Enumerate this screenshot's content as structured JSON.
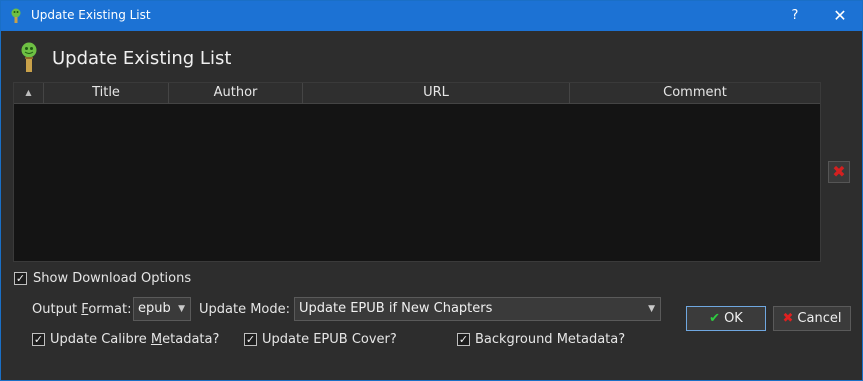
{
  "window": {
    "title": "Update Existing List",
    "help_label": "?",
    "close_label": "✕"
  },
  "header": {
    "title": "Update Existing List"
  },
  "table": {
    "sort_indicator": "▲",
    "columns": [
      "Title",
      "Author",
      "URL",
      "Comment"
    ],
    "rows": []
  },
  "remove_button": {
    "label": "✖"
  },
  "show_download_options": {
    "label": "Show Download Options",
    "checked": true
  },
  "output_format": {
    "label_pre": "Output ",
    "label_u": "F",
    "label_post": "ormat:",
    "value": "epub"
  },
  "update_mode": {
    "label": "Update Mode:",
    "value": "Update EPUB if New Chapters"
  },
  "options": {
    "update_calibre_pre": "Update Calibre ",
    "update_calibre_u": "M",
    "update_calibre_post": "etadata?",
    "update_epub_cover": "Update EPUB Cover?",
    "background_metadata": "Background Metadata?"
  },
  "buttons": {
    "ok": "OK",
    "cancel": "Cancel"
  },
  "colors": {
    "titlebar": "#1c72d4",
    "background": "#2d2d2d",
    "ok_icon": "#2ecc40",
    "cancel_icon": "#e02020"
  }
}
